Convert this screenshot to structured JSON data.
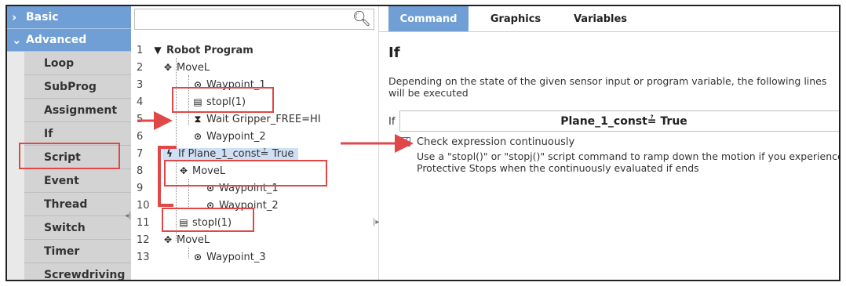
{
  "nav": {
    "categories": [
      {
        "label": "Basic",
        "chevron": "›"
      },
      {
        "label": "Advanced",
        "chevron": "⌄"
      }
    ],
    "items": [
      "Loop",
      "SubProg",
      "Assignment",
      "If",
      "Script",
      "Event",
      "Thread",
      "Switch",
      "Timer",
      "Screwdriving"
    ]
  },
  "tree": {
    "search_placeholder": "",
    "rows": [
      {
        "line": "1",
        "icon": "▼",
        "text": "Robot Program"
      },
      {
        "line": "2",
        "icon": "✥",
        "text": "MoveL"
      },
      {
        "line": "3",
        "icon": "⊙",
        "text": "Waypoint_1"
      },
      {
        "line": "4",
        "icon": "▤",
        "text": "stopl(1)"
      },
      {
        "line": "5",
        "icon": "⧗",
        "text": "Wait Gripper_FREE=HI"
      },
      {
        "line": "6",
        "icon": "⊙",
        "text": "Waypoint_2"
      },
      {
        "line": "7",
        "icon": "ϟ",
        "text": "If Plane_1_const≟ True"
      },
      {
        "line": "8",
        "icon": "✥",
        "text": "MoveL"
      },
      {
        "line": "9",
        "icon": "⊙",
        "text": "Waypoint_1"
      },
      {
        "line": "10",
        "icon": "⊙",
        "text": "Waypoint_2"
      },
      {
        "line": "11",
        "icon": "▤",
        "text": "stopl(1)"
      },
      {
        "line": "12",
        "icon": "✥",
        "text": "MoveL"
      },
      {
        "line": "13",
        "icon": "⊙",
        "text": "Waypoint_3"
      }
    ]
  },
  "tabs": [
    "Command",
    "Graphics",
    "Variables"
  ],
  "command": {
    "title": "If",
    "description": "Depending on the state of the given sensor input or program variable, the following lines will be executed",
    "if_label": "If",
    "expression": "Plane_1_const≟ True",
    "check_label": "Check expression continuously",
    "check_help": "Use a \"stopl()\" or \"stopj()\" script command to ramp down the motion if you experience Protective Stops when the continuously evaluated if ends"
  },
  "colors": {
    "accent": "#6f9fd4",
    "annotation": "#e04848",
    "selection": "#cfe0f5"
  }
}
